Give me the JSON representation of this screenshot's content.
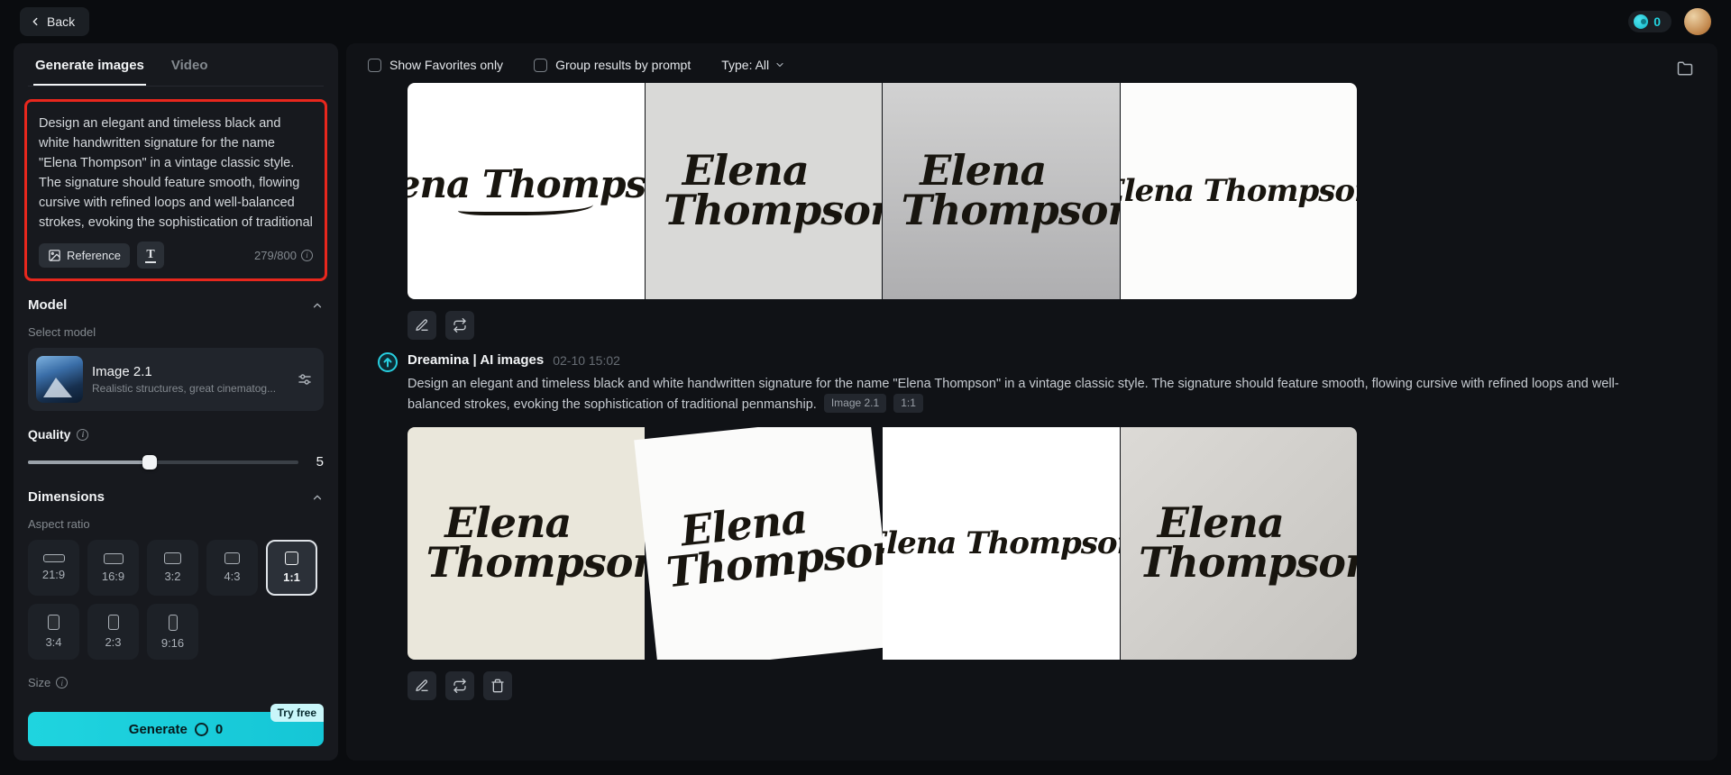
{
  "header": {
    "back": "Back",
    "credits": "0"
  },
  "sidebar": {
    "tabs": {
      "images": "Generate images",
      "video": "Video"
    },
    "prompt": {
      "value": "Design an elegant and timeless black and white handwritten signature for the name \"Elena Thompson\" in a vintage classic style. The signature should feature smooth, flowing cursive with refined loops and well-balanced strokes, evoking the sophistication of traditional penmanship.",
      "reference": "Reference",
      "counter": "279/800"
    },
    "model": {
      "title": "Model",
      "select_label": "Select model",
      "name": "Image 2.1",
      "desc": "Realistic structures, great cinematog..."
    },
    "quality": {
      "label": "Quality",
      "value": "5"
    },
    "dimensions": {
      "title": "Dimensions",
      "aspect_label": "Aspect ratio",
      "ratios": [
        "21:9",
        "16:9",
        "3:2",
        "4:3",
        "1:1",
        "3:4",
        "2:3",
        "9:16"
      ]
    },
    "size": {
      "label": "Size"
    },
    "generate": {
      "label": "Generate",
      "credits": "0",
      "try_free": "Try free"
    }
  },
  "main": {
    "toolbar": {
      "favorites": "Show Favorites only",
      "group": "Group results by prompt",
      "type": "Type: All"
    },
    "group": {
      "author": "Dreamina | AI images",
      "timestamp": "02-10  15:02",
      "prompt": "Design an elegant and timeless black and white handwritten signature for the name \"Elena Thompson\" in a vintage classic style. The signature should feature smooth, flowing cursive with refined loops and well-balanced strokes, evoking the sophistication of traditional penmanship.",
      "tags": [
        "Image 2.1",
        "1:1"
      ]
    },
    "signature": {
      "first": "Elena",
      "last": "Thompson",
      "full": "Elena Thompson"
    }
  },
  "colors": {
    "accent": "#1fd4df",
    "annotation": "#e8271d"
  }
}
